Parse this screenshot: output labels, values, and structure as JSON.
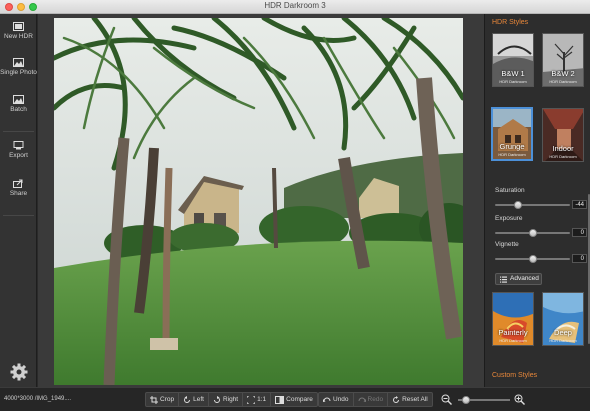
{
  "window": {
    "title": "HDR Darkroom 3"
  },
  "sidebar": {
    "items": [
      {
        "label": "New HDR",
        "icon": "new-hdr-icon"
      },
      {
        "label": "Single Photo",
        "icon": "single-photo-icon"
      },
      {
        "label": "Batch",
        "icon": "batch-icon"
      },
      {
        "label": "Export",
        "icon": "export-icon"
      },
      {
        "label": "Share",
        "icon": "share-icon"
      }
    ],
    "settings_icon": "gear-icon"
  },
  "right_panel": {
    "styles_title": "HDR Styles",
    "styles": [
      {
        "name": "B&W 1",
        "sub": "HDR Darkroom",
        "selected": false
      },
      {
        "name": "B&W 2",
        "sub": "HDR Darkroom",
        "selected": false
      },
      {
        "name": "Grunge",
        "sub": "HDR Darkroom",
        "selected": true
      },
      {
        "name": "Indoor",
        "sub": "HDR Darkroom",
        "selected": false
      },
      {
        "name": "Painterly",
        "sub": "HDR Darkroom",
        "selected": false
      },
      {
        "name": "Deep",
        "sub": "HDR Darkroom",
        "selected": false
      }
    ],
    "sliders": [
      {
        "label": "Saturation",
        "value": "-44",
        "level": 0.28
      },
      {
        "label": "Exposure",
        "value": "0",
        "level": 0.5
      },
      {
        "label": "Vignette",
        "value": "0",
        "level": 0.5
      }
    ],
    "advanced_label": "Advanced",
    "custom_title": "Custom Styles"
  },
  "bottom": {
    "file_info": "4000*3000 /IMG_1949....",
    "tools": [
      {
        "label": "Crop",
        "icon": "crop-icon"
      },
      {
        "label": "Left",
        "icon": "rotate-left-icon"
      },
      {
        "label": "Right",
        "icon": "rotate-right-icon"
      },
      {
        "label": "1:1",
        "icon": "actual-size-icon"
      },
      {
        "label": "Compare",
        "icon": "compare-icon"
      }
    ],
    "history": [
      {
        "label": "Undo",
        "icon": "undo-icon",
        "enabled": true
      },
      {
        "label": "Redo",
        "icon": "redo-icon",
        "enabled": false
      },
      {
        "label": "Reset All",
        "icon": "reset-icon",
        "enabled": true
      }
    ],
    "zoom_level": 0.1
  },
  "colors": {
    "accent": "#e8873a",
    "selection": "#4c90d8"
  }
}
